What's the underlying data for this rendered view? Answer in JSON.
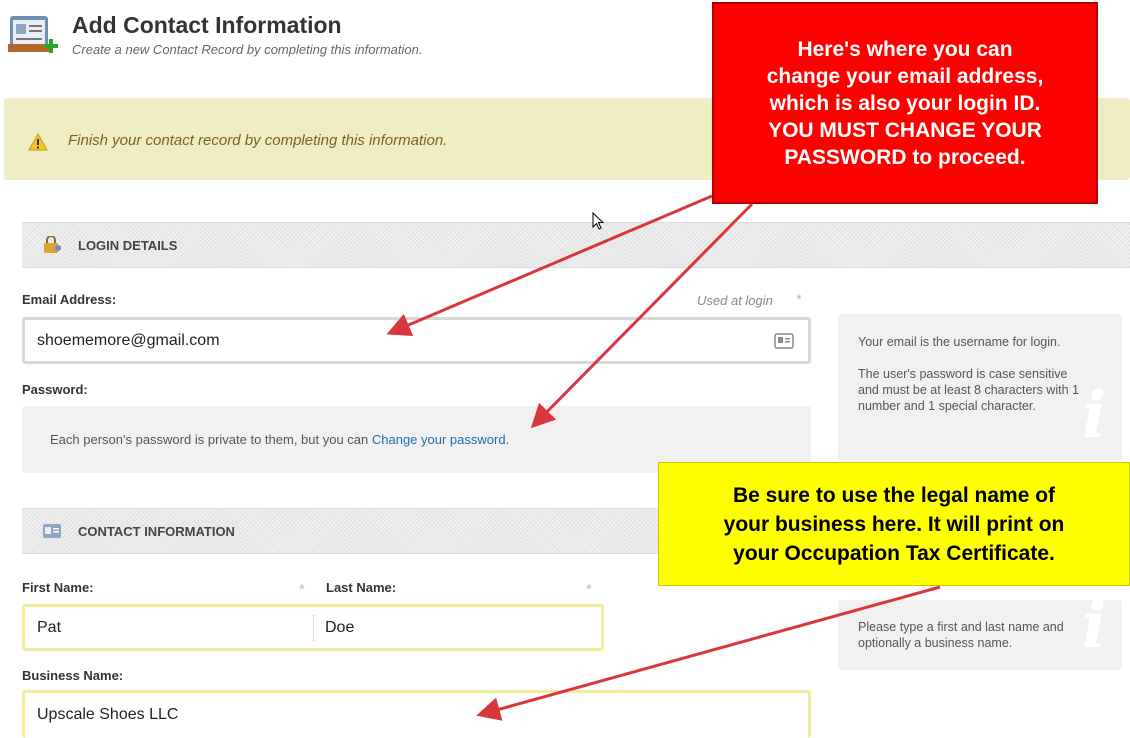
{
  "header": {
    "title": "Add Contact Information",
    "subtitle": "Create a new Contact Record by completing this information.",
    "icon": "contact-card-add-icon"
  },
  "warning": {
    "icon": "warning-triangle-icon",
    "text": "Finish your contact record by completing this information."
  },
  "login_section": {
    "label": "LOGIN DETAILS",
    "icon": "lock-user-icon",
    "email_label": "Email Address:",
    "email_hint": "Used at login",
    "required_mark": "*",
    "email_value": "shoememore@gmail.com",
    "password_label": "Password:",
    "password_text": "Each person's password is private to them, but you can ",
    "password_link": "Change your password",
    "password_end": "."
  },
  "email_info": {
    "line1": "Your email is the username for login.",
    "line2": "The user's password is case sensitive and must be at least 8 characters with 1 number and 1 special character."
  },
  "contact_section": {
    "label": "CONTACT INFORMATION",
    "icon": "contact-card-icon",
    "first_label": "First Name:",
    "last_label": "Last Name:",
    "required_mark": "*",
    "first_value": "Pat",
    "last_value": "Doe",
    "business_label": "Business Name:",
    "business_value": "Upscale Shoes LLC"
  },
  "name_info": {
    "text": "Please type a first and last name and optionally a business name."
  },
  "callouts": {
    "red": "Here's where you can\nchange your email address,\nwhich is also your login ID.\nYOU MUST CHANGE YOUR\nPASSWORD to proceed.",
    "yellow": "Be sure to use the legal name of\nyour business here. It will print on\nyour Occupation Tax Certificate."
  },
  "colors": {
    "warning_bg": "#f0ecc3",
    "link": "#1f6fad",
    "red_callout": "#ff0000",
    "yellow_callout": "#ffff00",
    "arrow": "#d9363e"
  }
}
